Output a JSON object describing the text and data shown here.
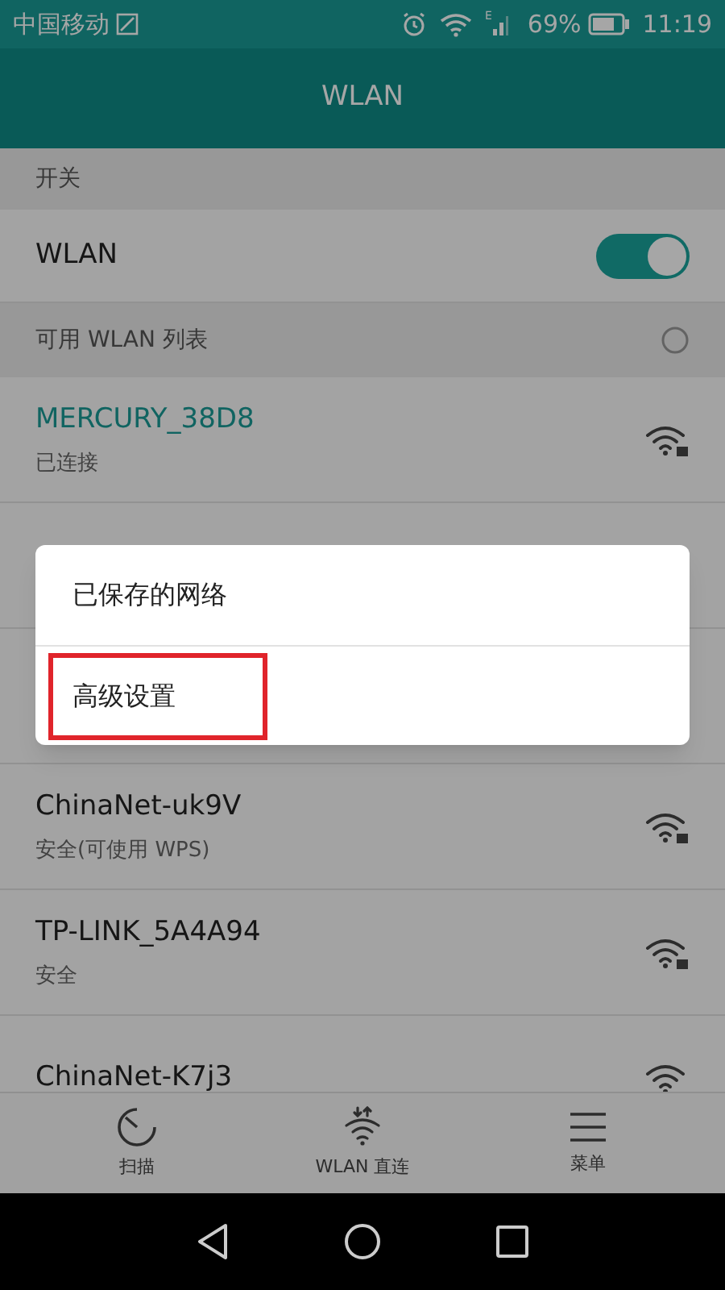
{
  "status_bar": {
    "carrier": "中国移动",
    "network_type": "E",
    "battery": "69%",
    "time": "11:19"
  },
  "header": {
    "title": "WLAN"
  },
  "switch_section": {
    "title": "开关"
  },
  "wlan_switch": {
    "label": "WLAN",
    "on": true
  },
  "list_section": {
    "title": "可用 WLAN 列表"
  },
  "networks": [
    {
      "name": "MERCURY_38D8",
      "status": "已连接",
      "connected": true,
      "secured": true
    },
    {
      "name": "ChinaNet-uk9V",
      "status": "安全(可使用 WPS)",
      "connected": false,
      "secured": true
    },
    {
      "name": "TP-LINK_5A4A94",
      "status": "安全",
      "connected": false,
      "secured": true
    },
    {
      "name": "ChinaNet-K7j3",
      "connected": false,
      "secured": false
    }
  ],
  "popup_menu": [
    {
      "label": "已保存的网络",
      "highlighted": false
    },
    {
      "label": "高级设置",
      "highlighted": true
    }
  ],
  "bottom_bar": [
    {
      "kind": "scan",
      "label": "扫描"
    },
    {
      "kind": "direct",
      "label": "WLAN 直连"
    },
    {
      "kind": "menu",
      "label": "菜单"
    }
  ]
}
